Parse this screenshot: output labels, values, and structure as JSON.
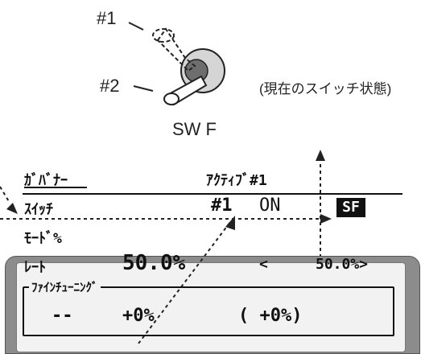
{
  "illustration": {
    "position_1_label": "#1",
    "position_2_label": "#2",
    "switch_name": "SW F",
    "current_state_note": "(現在のスイッチ状態)"
  },
  "lcd": {
    "title": "ｶﾞﾊﾞﾅｰ",
    "active_label": "ｱｸﾃｨﾌﾞ#1",
    "switch": {
      "label": "ｽｲｯﾁ",
      "position": "#1",
      "state": "ON",
      "assigned": "SF"
    },
    "mode": {
      "label": "ﾓｰﾄﾞ%"
    },
    "rate": {
      "label": "ﾚｰﾄ",
      "value": "50.0%",
      "open_bracket": "<",
      "total": "50.0%>"
    },
    "fine_tuning": {
      "label": "ﾌｧｲﾝﾁｭｰﾆﾝｸﾞ",
      "dial": "--",
      "value": "+0%",
      "total": "( +0%)"
    }
  }
}
